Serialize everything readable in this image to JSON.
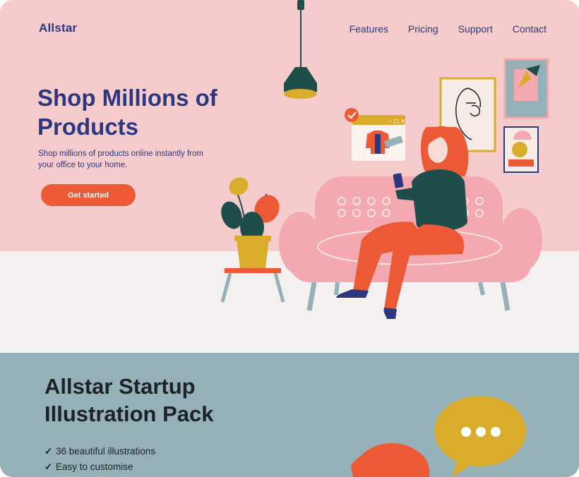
{
  "brand": {
    "name": "Allstar"
  },
  "nav": {
    "items": [
      "Features",
      "Pricing",
      "Support",
      "Contact"
    ]
  },
  "hero": {
    "title": "Shop Millions of Products",
    "subtitle": "Shop millions of products online instantly from your office to your home.",
    "cta_label": "Get started"
  },
  "pack": {
    "title": "Allstar Startup Illustration Pack",
    "features": [
      "36 beautiful illustrations",
      "Easy to customise"
    ]
  },
  "colors": {
    "hero_wall": "#f5cbcb",
    "floor": "#f5f0f0",
    "band": "#95b1b7",
    "navy": "#2b3880",
    "accent": "#eb5a35",
    "mustard": "#d9ad2b",
    "sofa": "#f4a9b1",
    "dark_green": "#1f4d4c"
  },
  "icons": [
    "check-icon",
    "check-badge-icon",
    "speech-bubble-icon",
    "pendant-lamp-icon",
    "plant-icon"
  ]
}
